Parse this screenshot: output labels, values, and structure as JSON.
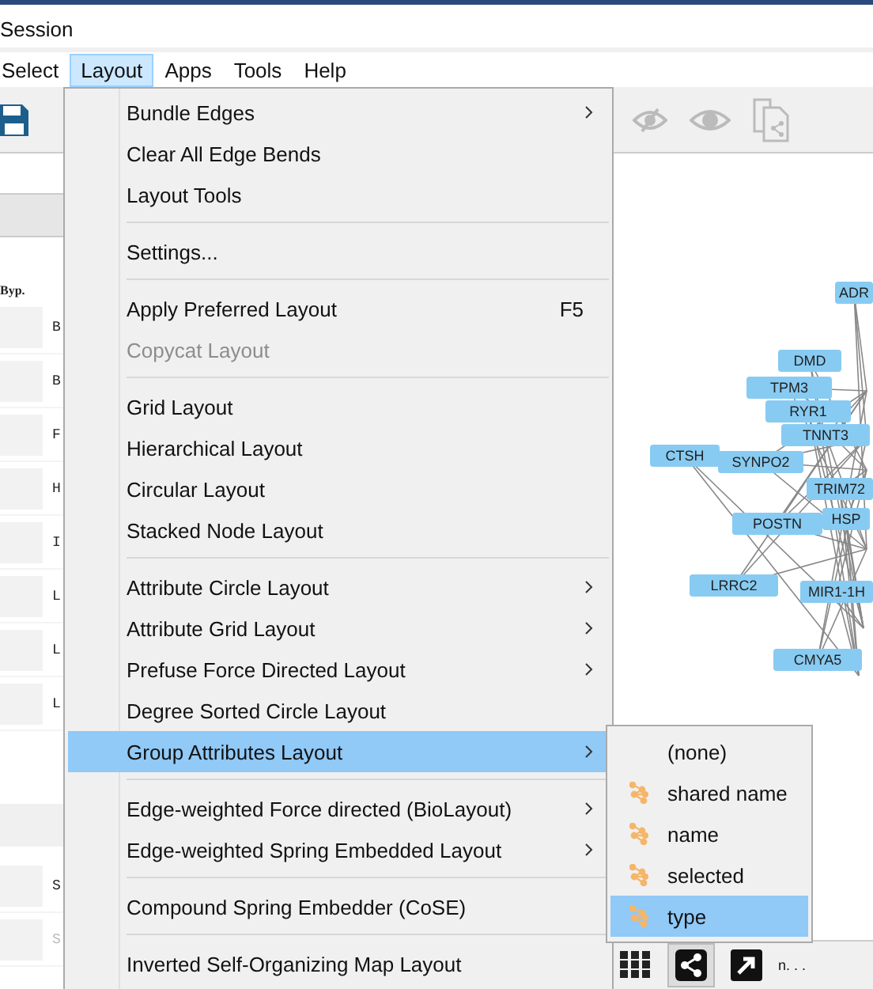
{
  "window": {
    "title": "Session"
  },
  "menubar": [
    {
      "label": "Select",
      "selected": false
    },
    {
      "label": "Layout",
      "selected": true
    },
    {
      "label": "Apps",
      "selected": false
    },
    {
      "label": "Tools",
      "selected": false
    },
    {
      "label": "Help",
      "selected": false
    }
  ],
  "table": {
    "column_1": "Byp.",
    "rows": [
      {
        "text": "B",
        "disabled": false
      },
      {
        "text": "B",
        "disabled": false
      },
      {
        "text": "F",
        "disabled": false
      },
      {
        "text": "H",
        "disabled": false
      },
      {
        "text": "I",
        "disabled": false
      },
      {
        "text": "L",
        "disabled": false
      },
      {
        "text": "L",
        "disabled": false
      },
      {
        "text": "L",
        "disabled": false
      }
    ],
    "rows_2": [
      {
        "text": "S",
        "disabled": false
      },
      {
        "text": "S",
        "disabled": true
      }
    ]
  },
  "layout_menu": {
    "items": [
      {
        "kind": "item",
        "label": "Bundle Edges",
        "submenu": true,
        "disabled": false,
        "selected": false
      },
      {
        "kind": "item",
        "label": "Clear All Edge Bends",
        "submenu": false,
        "disabled": false,
        "selected": false
      },
      {
        "kind": "item",
        "label": "Layout Tools",
        "submenu": false,
        "disabled": false,
        "selected": false
      },
      {
        "kind": "separator"
      },
      {
        "kind": "item",
        "label": "Settings...",
        "submenu": false,
        "disabled": false,
        "selected": false
      },
      {
        "kind": "separator"
      },
      {
        "kind": "item",
        "label": "Apply Preferred Layout",
        "shortcut": "F5",
        "submenu": false,
        "disabled": false,
        "selected": false
      },
      {
        "kind": "item",
        "label": "Copycat Layout",
        "submenu": false,
        "disabled": true,
        "selected": false
      },
      {
        "kind": "separator"
      },
      {
        "kind": "item",
        "label": "Grid Layout",
        "submenu": false,
        "disabled": false,
        "selected": false
      },
      {
        "kind": "item",
        "label": "Hierarchical Layout",
        "submenu": false,
        "disabled": false,
        "selected": false
      },
      {
        "kind": "item",
        "label": "Circular Layout",
        "submenu": false,
        "disabled": false,
        "selected": false
      },
      {
        "kind": "item",
        "label": "Stacked Node Layout",
        "submenu": false,
        "disabled": false,
        "selected": false
      },
      {
        "kind": "separator"
      },
      {
        "kind": "item",
        "label": "Attribute Circle Layout",
        "submenu": true,
        "disabled": false,
        "selected": false
      },
      {
        "kind": "item",
        "label": "Attribute Grid Layout",
        "submenu": true,
        "disabled": false,
        "selected": false
      },
      {
        "kind": "item",
        "label": "Prefuse Force Directed Layout",
        "submenu": true,
        "disabled": false,
        "selected": false
      },
      {
        "kind": "item",
        "label": "Degree Sorted Circle Layout",
        "submenu": false,
        "disabled": false,
        "selected": false
      },
      {
        "kind": "item",
        "label": "Group Attributes Layout",
        "submenu": true,
        "disabled": false,
        "selected": true
      },
      {
        "kind": "separator"
      },
      {
        "kind": "item",
        "label": "Edge-weighted Force directed (BioLayout)",
        "submenu": true,
        "disabled": false,
        "selected": false
      },
      {
        "kind": "item",
        "label": "Edge-weighted Spring Embedded Layout",
        "submenu": true,
        "disabled": false,
        "selected": false
      },
      {
        "kind": "separator"
      },
      {
        "kind": "item",
        "label": "Compound Spring Embedder (CoSE)",
        "submenu": false,
        "disabled": false,
        "selected": false
      },
      {
        "kind": "separator"
      },
      {
        "kind": "item",
        "label": "Inverted Self-Organizing Map Layout",
        "submenu": false,
        "disabled": false,
        "selected": false
      }
    ]
  },
  "submenu": {
    "items": [
      {
        "label": "(none)",
        "icon": false,
        "selected": false
      },
      {
        "label": "shared name",
        "icon": true,
        "selected": false
      },
      {
        "label": "name",
        "icon": true,
        "selected": false
      },
      {
        "label": "selected",
        "icon": true,
        "selected": false
      },
      {
        "label": "type",
        "icon": true,
        "selected": true
      }
    ]
  },
  "network": {
    "nodes": [
      {
        "label": "ADR"
      },
      {
        "label": "DMD"
      },
      {
        "label": "TPM3"
      },
      {
        "label": "RYR1"
      },
      {
        "label": "TNNT3"
      },
      {
        "label": "CTSH"
      },
      {
        "label": "SYNPO2"
      },
      {
        "label": "TRIM72"
      },
      {
        "label": "POSTN"
      },
      {
        "label": "HSP"
      },
      {
        "label": "LRRC2"
      },
      {
        "label": "MIR1-1H"
      },
      {
        "label": "CMYA5"
      }
    ]
  },
  "bottom_bar": {
    "label": "n. . ."
  }
}
